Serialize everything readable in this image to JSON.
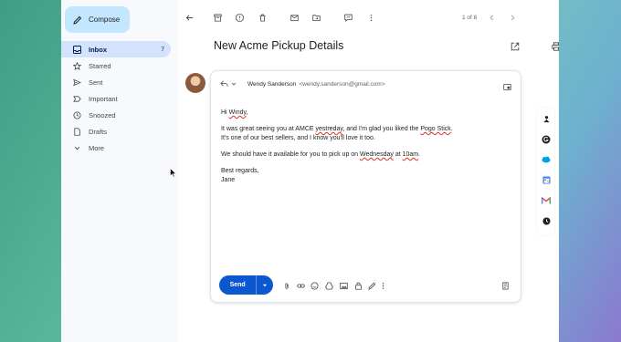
{
  "sidebar": {
    "compose_label": "Compose",
    "items": [
      {
        "label": "Inbox",
        "icon": "inbox-icon",
        "count": "7",
        "active": true
      },
      {
        "label": "Starred",
        "icon": "star-icon"
      },
      {
        "label": "Sent",
        "icon": "send-icon"
      },
      {
        "label": "Important",
        "icon": "important-icon"
      },
      {
        "label": "Snoozed",
        "icon": "clock-icon"
      },
      {
        "label": "Drafts",
        "icon": "draft-icon"
      },
      {
        "label": "More",
        "icon": "chevron-down-icon"
      }
    ]
  },
  "toolbar": {
    "pager": "1 of 8"
  },
  "email": {
    "subject": "New Acme Pickup Details",
    "sender_name": "Wendy Sanderson",
    "sender_email": "<wendy.sanderson@gmail.com>"
  },
  "reply": {
    "greeting_pre": "Hi ",
    "greeting_name": "Windy",
    "greeting_post": ",",
    "p1_a": "It was great seeing you at AMCE ",
    "p1_b": "yestreday",
    "p1_c": ", and I'm glad you liked the ",
    "p1_d": "Pogo Stick",
    "p1_e": ".",
    "p1_line2": "It's one of our best sellers, and I know you'll love it too.",
    "p2_a": "We should have it available for you to pick up on ",
    "p2_b": "Wednesday",
    "p2_c": " at ",
    "p2_d": "10am",
    "p2_e": ".",
    "signoff": "Best regards,",
    "signature": "Jane",
    "send_label": "Send"
  },
  "colors": {
    "accent": "#0b57d0",
    "nav_active": "#d3e3fd",
    "compose_bg": "#c2e7ff",
    "spell_error": "#d93025"
  }
}
